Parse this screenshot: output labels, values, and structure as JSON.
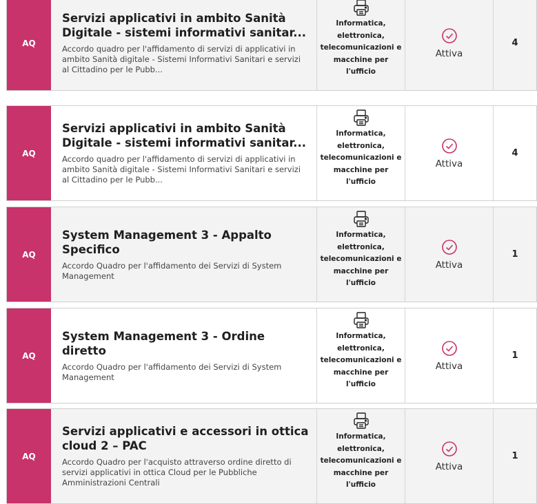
{
  "accent_color": "#c7336a",
  "rows": [
    {
      "tag": "AQ",
      "title": "Servizi applicativi in ambito Sanità Digitale - sistemi informativi sanitar...",
      "description": "Accordo quadro per l'affidamento di servizi di applicativi in ambito Sanità digitale - Sistemi Informativi Sanitari e servizi al Cittadino per le Pubb...",
      "category_icon": "printer-icon",
      "category": "Informatica, elettronica, telecomunicazioni e macchine per l'ufficio",
      "status_icon": "check-circle-icon",
      "status": "Attiva",
      "count": "4"
    },
    {
      "tag": "AQ",
      "title": "Servizi applicativi in ambito Sanità Digitale - sistemi informativi sanitar...",
      "description": "Accordo quadro per l'affidamento di servizi di applicativi in ambito Sanità digitale - Sistemi Informativi Sanitari e servizi al Cittadino per le Pubb...",
      "category_icon": "printer-icon",
      "category": "Informatica, elettronica, telecomunicazioni e macchine per l'ufficio",
      "status_icon": "check-circle-icon",
      "status": "Attiva",
      "count": "4"
    },
    {
      "tag": "AQ",
      "title": "System Management 3 - Appalto Specifico",
      "description": "Accordo Quadro per l'affidamento dei Servizi di System Management",
      "category_icon": "printer-icon",
      "category": "Informatica, elettronica, telecomunicazioni e macchine per l'ufficio",
      "status_icon": "check-circle-icon",
      "status": "Attiva",
      "count": "1"
    },
    {
      "tag": "AQ",
      "title": "System Management 3 - Ordine diretto",
      "description": "Accordo Quadro per l'affidamento dei Servizi di System Management",
      "category_icon": "printer-icon",
      "category": "Informatica, elettronica, telecomunicazioni e macchine per l'ufficio",
      "status_icon": "check-circle-icon",
      "status": "Attiva",
      "count": "1"
    },
    {
      "tag": "AQ",
      "title": "Servizi applicativi e accessori in ottica cloud 2 – PAC",
      "description": "Accordo Quadro per l'acquisto attraverso ordine diretto di servizi applicativi in ottica Cloud per le Pubbliche Amministrazioni Centrali",
      "category_icon": "printer-icon",
      "category": "Informatica, elettronica, telecomunicazioni e macchine per l'ufficio",
      "status_icon": "check-circle-icon",
      "status": "Attiva",
      "count": "1"
    }
  ]
}
